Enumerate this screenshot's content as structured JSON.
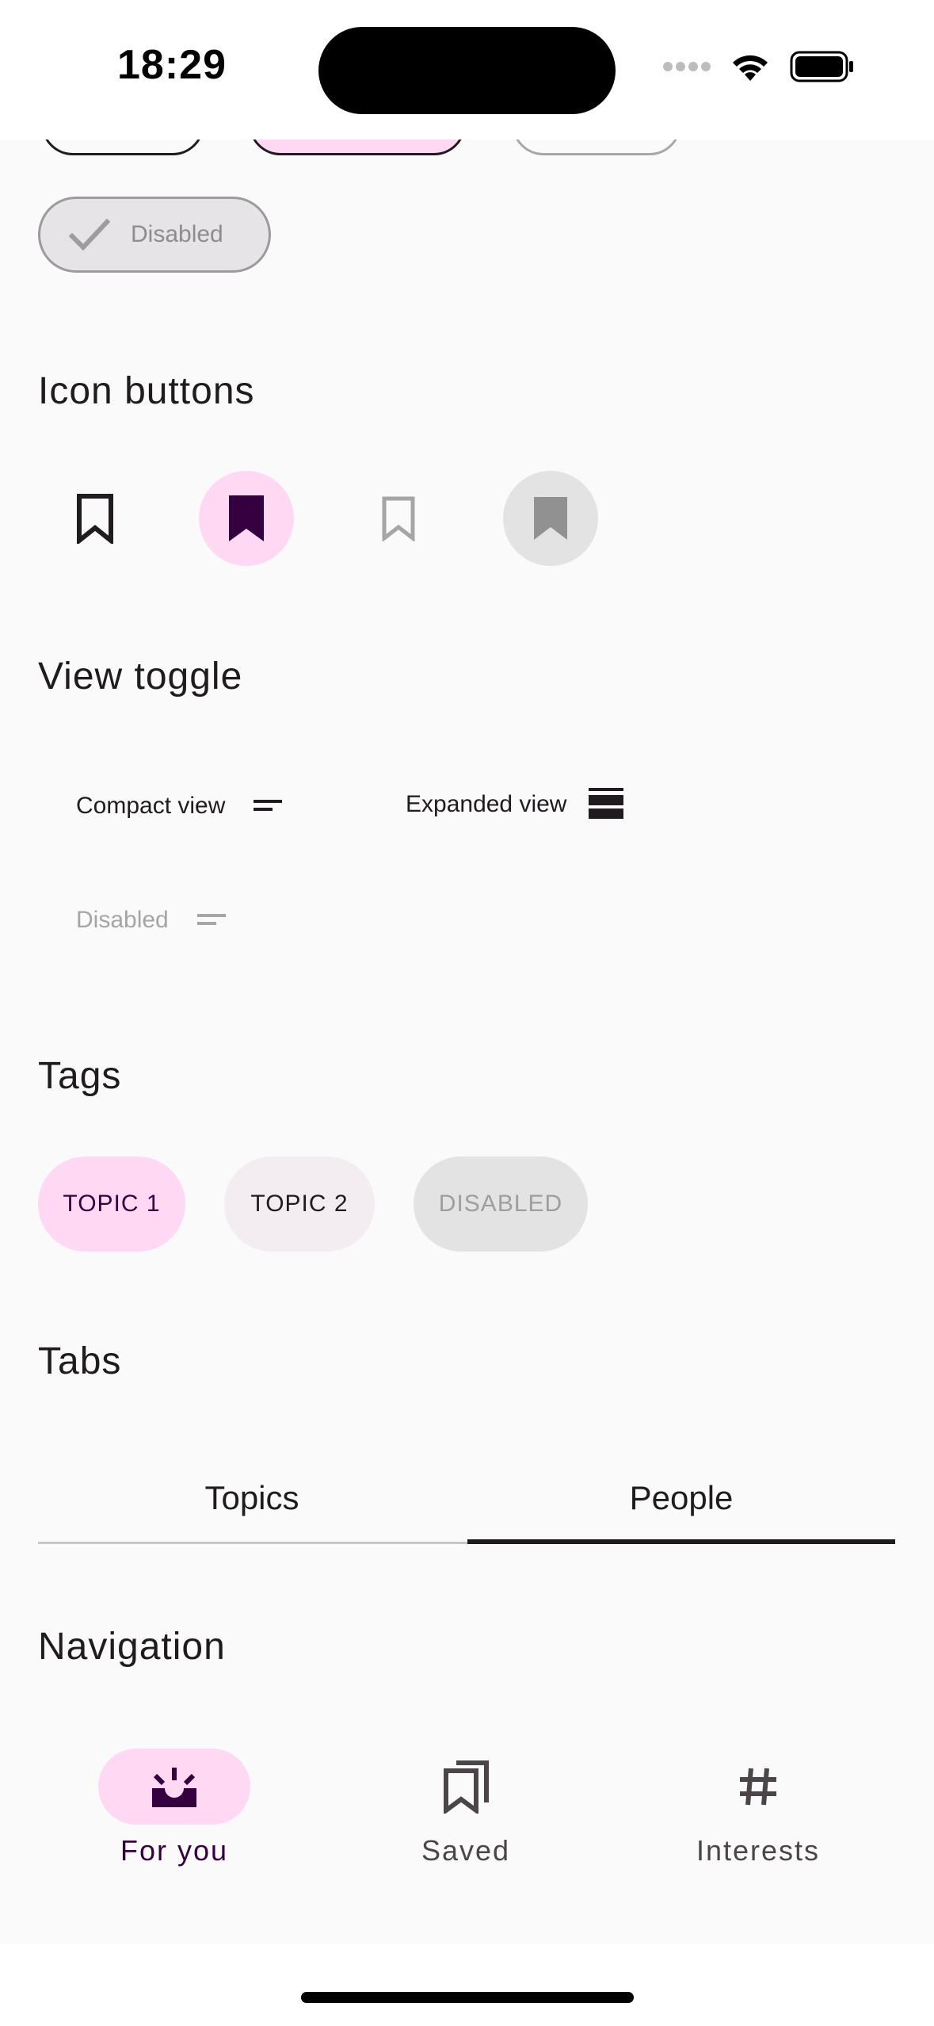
{
  "status_bar": {
    "time": "18:29"
  },
  "chips": {
    "disabled_label": "Disabled"
  },
  "sections": {
    "icon_buttons": "Icon buttons",
    "view_toggle": "View toggle",
    "tags": "Tags",
    "tabs": "Tabs",
    "navigation": "Navigation"
  },
  "view_toggle": {
    "compact_label": "Compact view",
    "expanded_label": "Expanded view",
    "disabled_label": "Disabled"
  },
  "tags": [
    {
      "label": "TOPIC 1"
    },
    {
      "label": "TOPIC 2"
    },
    {
      "label": "DISABLED"
    }
  ],
  "tabs": [
    {
      "label": "Topics",
      "selected": false
    },
    {
      "label": "People",
      "selected": true
    }
  ],
  "navigation": {
    "items": [
      {
        "label": "For you",
        "icon": "upcoming-icon",
        "selected": true
      },
      {
        "label": "Saved",
        "icon": "bookmarks-icon",
        "selected": false
      },
      {
        "label": "Interests",
        "icon": "hashtag-icon",
        "selected": false
      }
    ]
  },
  "colors": {
    "background": "#FAFAFA",
    "selected_container": "#FFD8F4",
    "selected_on_container": "#35003F",
    "tag_secondary": "#F3EDF1",
    "disabled_container": "#E3E3E3",
    "disabled_content": "#9E9E9E",
    "text": "#1F1B1E"
  }
}
